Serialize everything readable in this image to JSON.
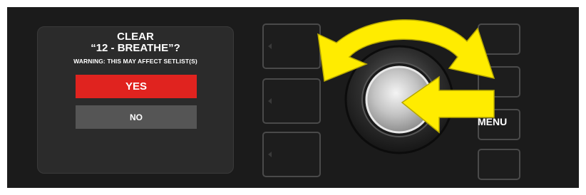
{
  "dialog": {
    "title_line1": "CLEAR",
    "title_line2": "“12 - BREATHE”?",
    "warning": "WARNING: THIS MAY AFFECT SETLIST(S)",
    "yes_label": "YES",
    "no_label": "NO"
  },
  "controls": {
    "menu_label": "MENU"
  },
  "colors": {
    "panel": "#1b1b1b",
    "yes_button": "#e0231f",
    "no_button": "#555555",
    "arrow": "#ffec00"
  },
  "icons": [
    "rotate-arrow-icon",
    "press-arrow-icon"
  ]
}
